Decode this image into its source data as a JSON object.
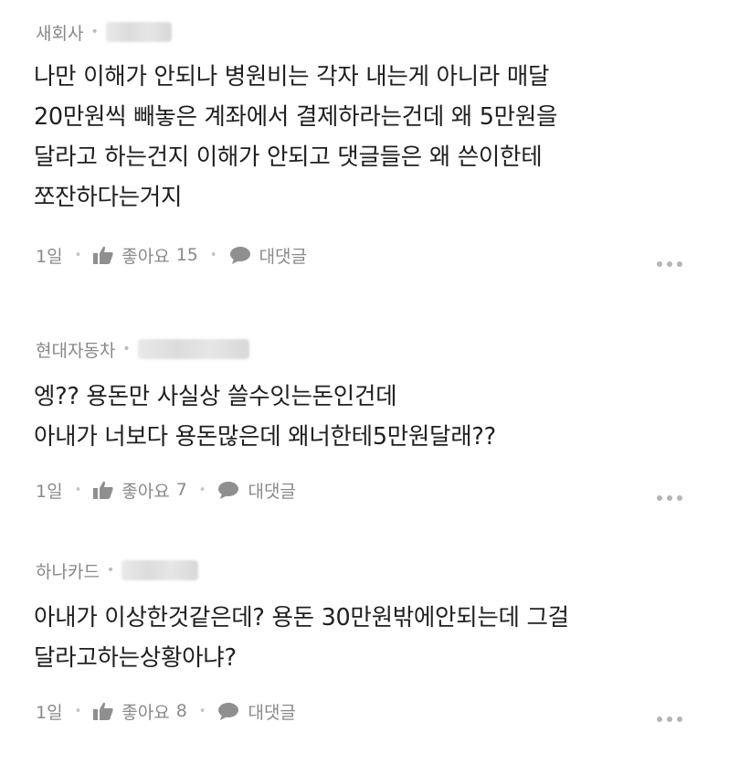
{
  "comments": [
    {
      "author": "새회사",
      "lines": [
        "나만 이해가 안되나 병원비는 각자 내는게 아니라 매달",
        "20만원씩 빼놓은 계좌에서 결제하라는건데 왜 5만원을",
        "달라고 하는건지 이해가 안되고 댓글들은 왜 쓴이한테",
        "쪼잔하다는거지"
      ],
      "time": "1일",
      "like_label": "좋아요",
      "like_count": "15",
      "reply_label": "대댓글"
    },
    {
      "author": "현대자동차",
      "lines": [
        "엥?? 용돈만 사실상 쓸수잇는돈인건데",
        "아내가 너보다 용돈많은데 왜너한테5만원달래??"
      ],
      "time": "1일",
      "like_label": "좋아요",
      "like_count": "7",
      "reply_label": "대댓글"
    },
    {
      "author": "하나카드",
      "lines": [
        "아내가 이상한것같은데? 용돈 30만원밖에안되는데 그걸",
        "달라고하는상황아냐?"
      ],
      "time": "1일",
      "like_label": "좋아요",
      "like_count": "8",
      "reply_label": "대댓글"
    }
  ],
  "icons": {
    "like": "thumbs-up-icon",
    "reply": "speech-bubble-icon",
    "more": "more-dots-icon"
  },
  "colors": {
    "text": "#1f1f1f",
    "meta": "#8a8a8a",
    "icon": "#8f8f8f"
  }
}
